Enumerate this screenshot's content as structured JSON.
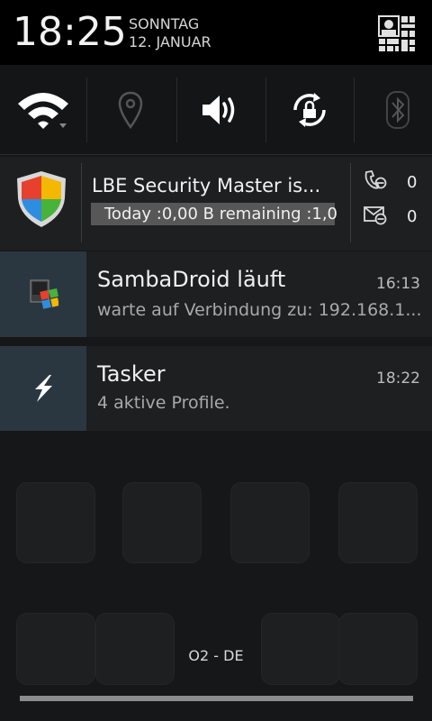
{
  "status": {
    "time": "18:25",
    "weekday": "SONNTAG",
    "date": "12. JANUAR"
  },
  "icons": {
    "settings": "settings-user-icon",
    "wifi": "wifi-icon",
    "location": "location-pin-icon",
    "sound": "speaker-volume-icon",
    "rotation": "rotation-lock-icon",
    "bluetooth": "bluetooth-icon",
    "lbe": "shield-icon",
    "calls": "phone-blocked-icon",
    "sms": "sms-blocked-icon",
    "samba": "sambadroid-icon",
    "tasker": "lightning-bolt-icon"
  },
  "notifications": {
    "lbe": {
      "title": "LBE Security Master is...",
      "info": "Today :0,00 B remaining :1,0",
      "calls_count": "0",
      "sms_count": "0"
    },
    "samba": {
      "title": "SambaDroid läuft",
      "time": "16:13",
      "text": "warte auf Verbindung zu: 192.168.1..."
    },
    "tasker": {
      "title": "Tasker",
      "time": "18:22",
      "text": "4 aktive Profile."
    }
  },
  "carrier": "O2 - DE",
  "colors": {
    "shade_background": "#161718",
    "notification_background": "#1d1f20",
    "app_icon_background": "#2b3740"
  }
}
